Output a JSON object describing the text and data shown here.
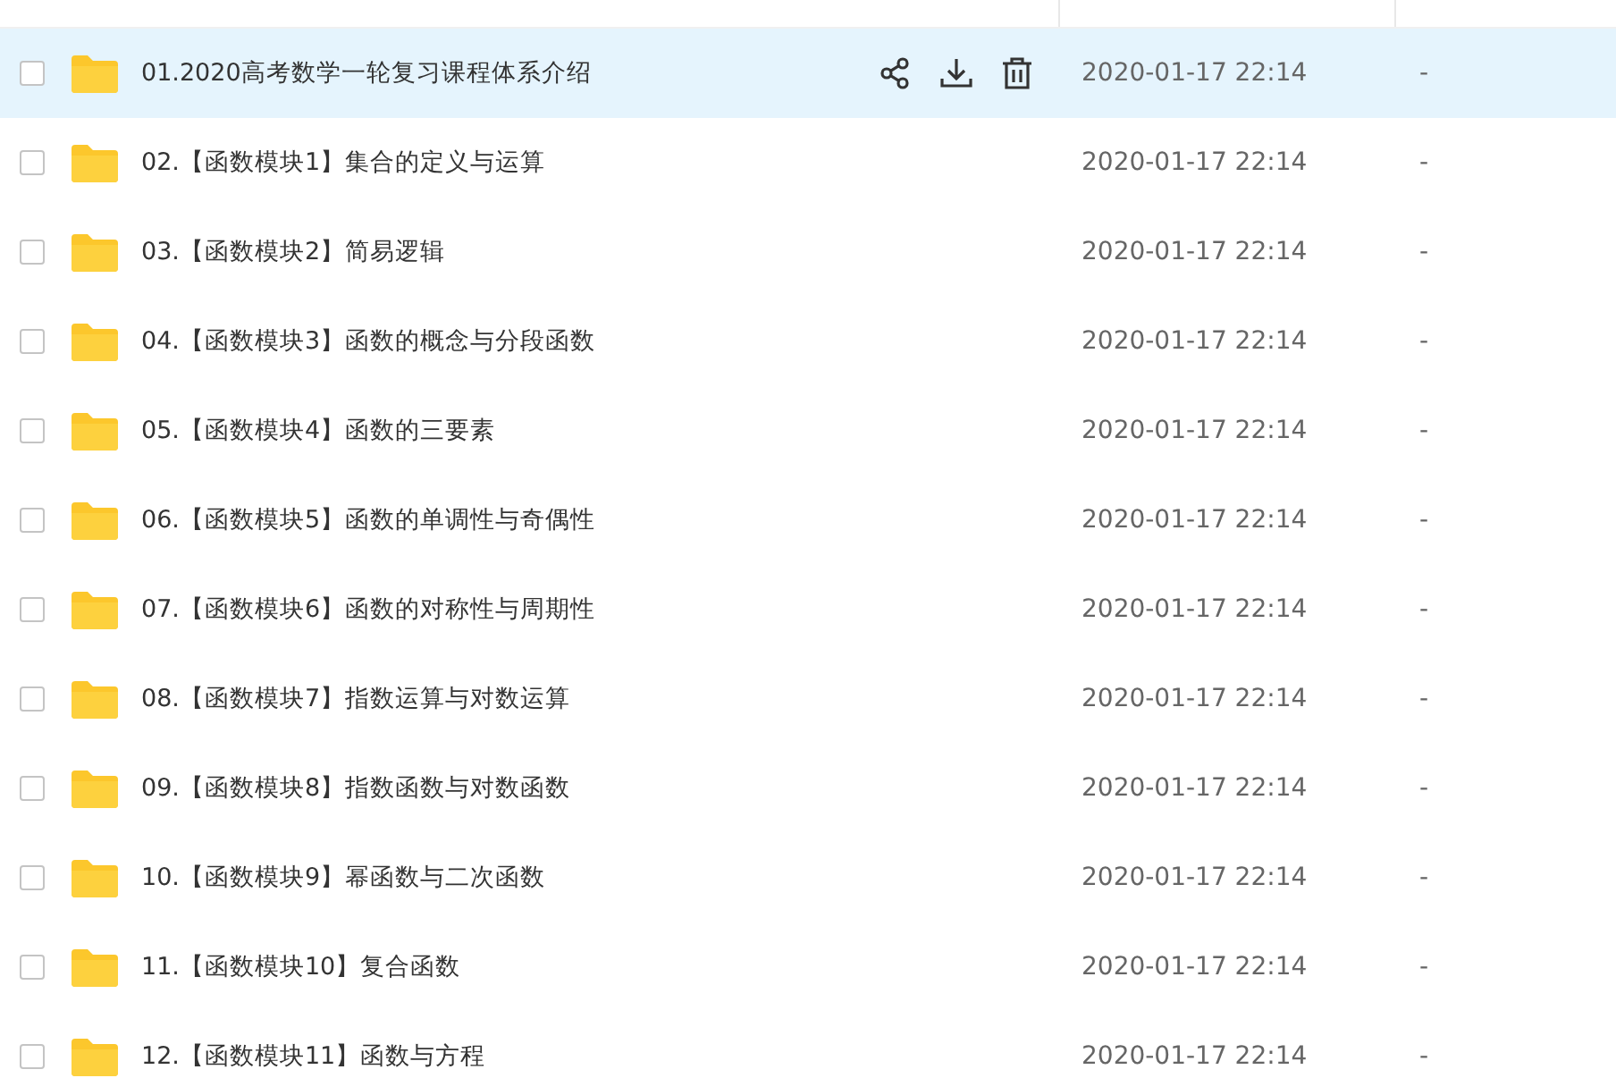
{
  "files": [
    {
      "name": "01.2020高考数学一轮复习课程体系介绍",
      "modified": "2020-01-17 22:14",
      "size": "-",
      "selected": true,
      "checked": false
    },
    {
      "name": "02.【函数模块1】集合的定义与运算",
      "modified": "2020-01-17 22:14",
      "size": "-",
      "selected": false,
      "checked": false
    },
    {
      "name": "03.【函数模块2】简易逻辑",
      "modified": "2020-01-17 22:14",
      "size": "-",
      "selected": false,
      "checked": false
    },
    {
      "name": "04.【函数模块3】函数的概念与分段函数",
      "modified": "2020-01-17 22:14",
      "size": "-",
      "selected": false,
      "checked": false
    },
    {
      "name": "05.【函数模块4】函数的三要素",
      "modified": "2020-01-17 22:14",
      "size": "-",
      "selected": false,
      "checked": false
    },
    {
      "name": "06.【函数模块5】函数的单调性与奇偶性",
      "modified": "2020-01-17 22:14",
      "size": "-",
      "selected": false,
      "checked": false
    },
    {
      "name": "07.【函数模块6】函数的对称性与周期性",
      "modified": "2020-01-17 22:14",
      "size": "-",
      "selected": false,
      "checked": false
    },
    {
      "name": "08.【函数模块7】指数运算与对数运算",
      "modified": "2020-01-17 22:14",
      "size": "-",
      "selected": false,
      "checked": false
    },
    {
      "name": "09.【函数模块8】指数函数与对数函数",
      "modified": "2020-01-17 22:14",
      "size": "-",
      "selected": false,
      "checked": false
    },
    {
      "name": "10.【函数模块9】幂函数与二次函数",
      "modified": "2020-01-17 22:14",
      "size": "-",
      "selected": false,
      "checked": false
    },
    {
      "name": "11.【函数模块10】复合函数",
      "modified": "2020-01-17 22:14",
      "size": "-",
      "selected": false,
      "checked": false
    },
    {
      "name": "12.【函数模块11】函数与方程",
      "modified": "2020-01-17 22:14",
      "size": "-",
      "selected": false,
      "checked": false
    }
  ]
}
